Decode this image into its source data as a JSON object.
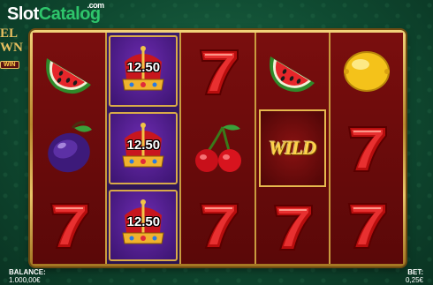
{
  "watermark": {
    "slot": "Slot",
    "catalog": "Catalog",
    "com": ".com"
  },
  "game_logo": {
    "line1": "EL",
    "line2": "WN",
    "line3": "WIN"
  },
  "reels": [
    [
      "watermelon-icon",
      "plum-icon",
      "seven-icon"
    ],
    [
      "crown-icon",
      "crown-icon",
      "crown-icon"
    ],
    [
      "seven-icon",
      "cherry-icon",
      "seven-icon"
    ],
    [
      "watermelon-icon",
      "wild-icon",
      "seven-icon"
    ],
    [
      "lemon-icon",
      "seven-icon",
      "seven-icon"
    ]
  ],
  "crown_values": [
    "12.50",
    "12.50",
    "12.50"
  ],
  "wild_label": "WILD",
  "balance": {
    "label": "BALANCE:",
    "value": "1.000,00€"
  },
  "bet": {
    "label": "BET:",
    "value": "0,25€"
  },
  "colors": {
    "felt": "#0f4a31",
    "reel_bg": "#6a0a0a",
    "gold": "#e8c060",
    "purple": "#4a1a8a"
  }
}
